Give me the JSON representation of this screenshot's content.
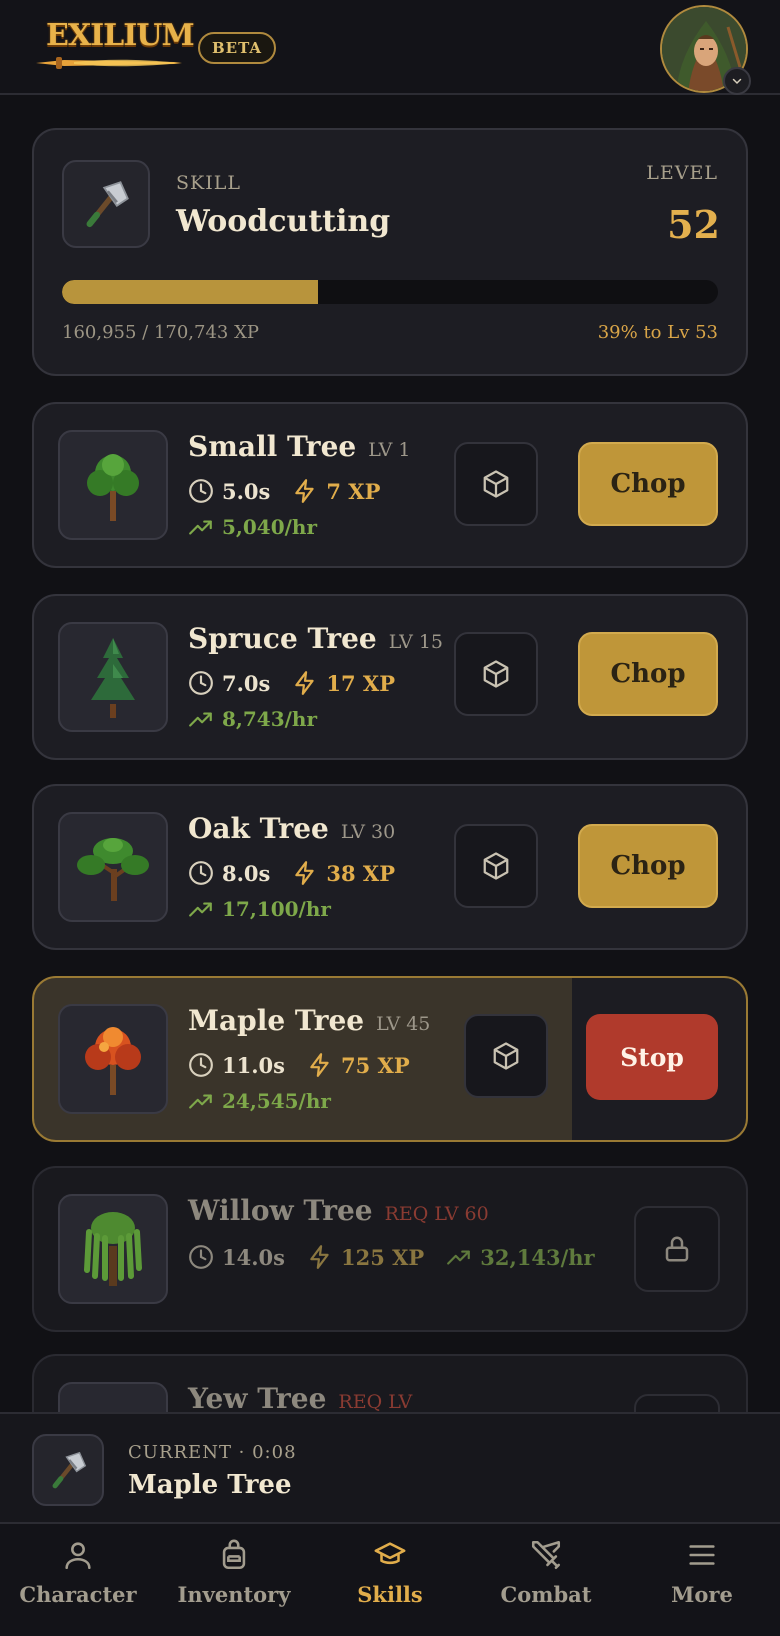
{
  "header": {
    "logo_text": "EXILIUM",
    "badge": "BETA"
  },
  "skill": {
    "label": "SKILL",
    "name": "Woodcutting",
    "level_label": "LEVEL",
    "level": "52",
    "xp_text": "160,955 / 170,743 XP",
    "progress_percent": 39,
    "progress_text": "39% to Lv 53"
  },
  "trees": [
    {
      "name": "Small Tree",
      "level": "LV 1",
      "time": "5.0s",
      "xp": "7 XP",
      "rate": "5,040/hr",
      "action": "Chop",
      "state": "available"
    },
    {
      "name": "Spruce Tree",
      "level": "LV 15",
      "time": "7.0s",
      "xp": "17 XP",
      "rate": "8,743/hr",
      "action": "Chop",
      "state": "available"
    },
    {
      "name": "Oak Tree",
      "level": "LV 30",
      "time": "8.0s",
      "xp": "38 XP",
      "rate": "17,100/hr",
      "action": "Chop",
      "state": "available"
    },
    {
      "name": "Maple Tree",
      "level": "LV 45",
      "time": "11.0s",
      "xp": "75 XP",
      "rate": "24,545/hr",
      "action": "Stop",
      "state": "active"
    },
    {
      "name": "Willow Tree",
      "level": "REQ LV 60",
      "time": "14.0s",
      "xp": "125 XP",
      "rate": "32,143/hr",
      "state": "locked"
    },
    {
      "name": "Yew Tree",
      "level": "REQ LV",
      "state": "locked"
    }
  ],
  "current": {
    "label": "CURRENT · 0:08",
    "name": "Maple Tree"
  },
  "nav": {
    "items": [
      {
        "label": "Character",
        "icon": "person-icon"
      },
      {
        "label": "Inventory",
        "icon": "backpack-icon"
      },
      {
        "label": "Skills",
        "icon": "graduation-cap-icon",
        "active": true
      },
      {
        "label": "Combat",
        "icon": "crossed-swords-icon"
      },
      {
        "label": "More",
        "icon": "menu-icon"
      }
    ]
  },
  "colors": {
    "accent": "#e1ad4b",
    "chop_button": "#bf9639",
    "stop_button": "#b03a2c",
    "rate_green": "#7ea84a"
  }
}
